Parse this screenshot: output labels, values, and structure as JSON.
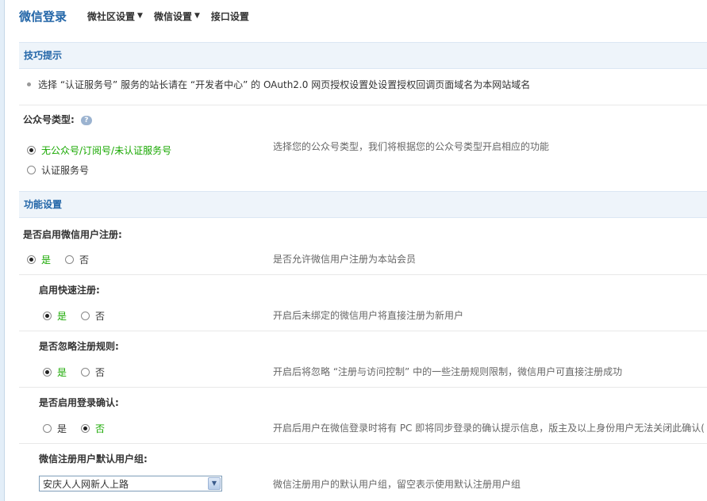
{
  "nav": {
    "title": "微信登录",
    "items": [
      {
        "label": "微社区设置",
        "caret": "▼"
      },
      {
        "label": "微信设置",
        "caret": "▼"
      },
      {
        "label": "接口设置"
      }
    ]
  },
  "tips": {
    "header": "技巧提示",
    "text": "选择 “认证服务号” 服务的站长请在 “开发者中心” 的  OAuth2.0 网页授权设置处设置授权回调页面域名为本网站域名"
  },
  "account_type": {
    "label": "公众号类型:",
    "help_icon": "?",
    "options": [
      "无公众号/订阅号/未认证服务号",
      "认证服务号"
    ],
    "selected": 0,
    "desc": "选择您的公众号类型，我们将根据您的公众号类型开启相应的功能"
  },
  "features": {
    "header": "功能设置",
    "settings": [
      {
        "label": "是否启用微信用户注册:",
        "yes": "是",
        "no": "否",
        "selected": "yes",
        "desc": "是否允许微信用户注册为本站会员"
      },
      {
        "label": "启用快速注册:",
        "yes": "是",
        "no": "否",
        "selected": "yes",
        "desc": "开启后未绑定的微信用户将直接注册为新用户"
      },
      {
        "label": "是否忽略注册规则:",
        "yes": "是",
        "no": "否",
        "selected": "yes",
        "desc": "开启后将忽略 “注册与访问控制” 中的一些注册规则限制，微信用户可直接注册成功"
      },
      {
        "label": "是否启用登录确认:",
        "yes": "是",
        "no": "否",
        "selected": "no",
        "desc": "开启后用户在微信登录时将有  PC 即将同步登录的确认提示信息，版主及以上身份用户无法关闭此确认("
      }
    ],
    "default_group": {
      "label": "微信注册用户默认用户组:",
      "value": "安庆人人网新人上路",
      "desc": "微信注册用户的默认用户组，留空表示使用默认注册用户组"
    }
  }
}
